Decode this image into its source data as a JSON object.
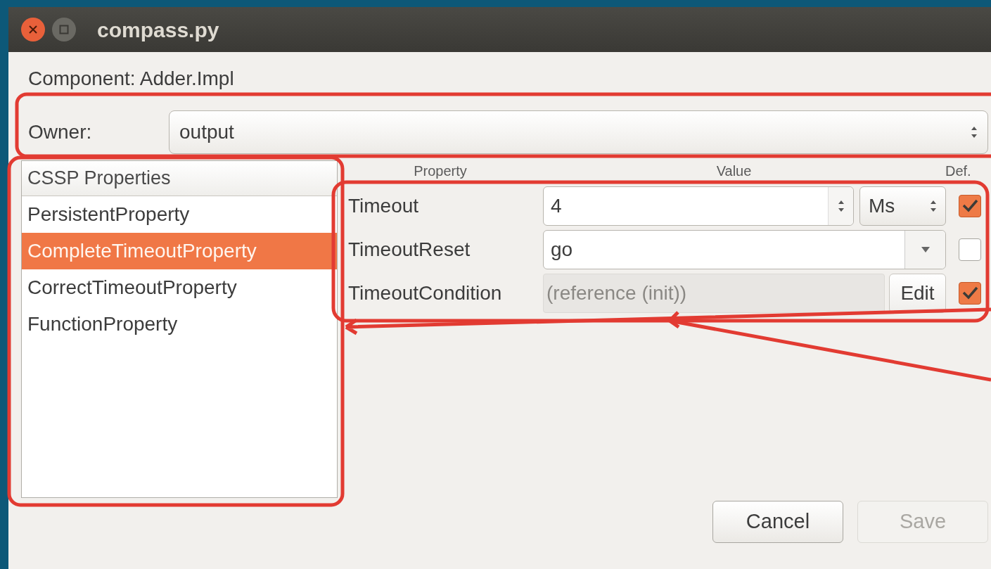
{
  "window": {
    "title": "compass.py"
  },
  "component_label": "Component: Adder.Impl",
  "owner": {
    "label": "Owner:",
    "value": "output"
  },
  "properties_list": {
    "header": "CSSP Properties",
    "items": [
      {
        "label": "PersistentProperty",
        "selected": false
      },
      {
        "label": "CompleteTimeoutProperty",
        "selected": true
      },
      {
        "label": "CorrectTimeoutProperty",
        "selected": false
      },
      {
        "label": "FunctionProperty",
        "selected": false
      }
    ]
  },
  "property_table": {
    "columns": [
      "Property",
      "Value",
      "Def."
    ],
    "rows": [
      {
        "kind": "spin",
        "name": "Timeout",
        "value": "4",
        "unit": "Ms",
        "default": true
      },
      {
        "kind": "combo",
        "name": "TimeoutReset",
        "value": "go",
        "default": false
      },
      {
        "kind": "reference",
        "name": "TimeoutCondition",
        "value": "(reference (init))",
        "button": "Edit",
        "default": true,
        "disabled": true
      }
    ]
  },
  "buttons": [
    {
      "label": "Cancel",
      "disabled": false
    },
    {
      "label": "Save",
      "disabled": true
    }
  ]
}
